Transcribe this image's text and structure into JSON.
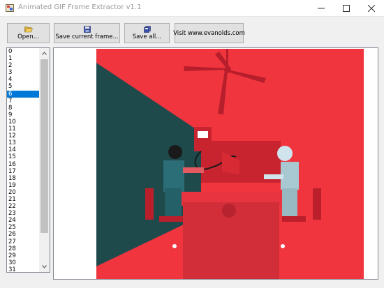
{
  "window": {
    "title": "Animated GIF Frame Extractor v1.1",
    "controls": [
      "minimize-icon",
      "maximize-icon",
      "close-icon"
    ]
  },
  "toolbar": {
    "open_label": "Open...",
    "open_icon": "folder-open-icon",
    "save_current_label": "Save current frame...",
    "save_current_icon": "floppy-disk-icon",
    "save_all_label": "Save all...",
    "save_all_icon": "save-all-icon",
    "visit_label": "Visit www.evanolds.com"
  },
  "frame_list": {
    "items": [
      "0",
      "1",
      "2",
      "3",
      "4",
      "5",
      "6",
      "7",
      "8",
      "9",
      "10",
      "11",
      "12",
      "13",
      "14",
      "15",
      "16",
      "17",
      "18",
      "19",
      "20",
      "21",
      "22",
      "23",
      "24",
      "25",
      "26",
      "27",
      "28",
      "29",
      "30",
      "31"
    ],
    "selected_index": 6
  },
  "preview": {
    "colors": {
      "background": "#f0353f",
      "shadow": "#1f4a4c",
      "accent": "#0078d7"
    }
  }
}
